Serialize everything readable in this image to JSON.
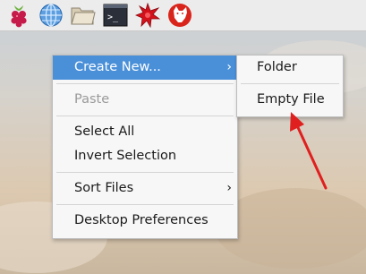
{
  "taskbar": {
    "items": [
      {
        "icon": "raspberry-menu-icon"
      },
      {
        "icon": "web-browser-globe-icon"
      },
      {
        "icon": "file-manager-folder-icon"
      },
      {
        "icon": "terminal-icon",
        "glyph": ">_"
      },
      {
        "icon": "mathematica-star-icon"
      },
      {
        "icon": "wolfram-wolf-icon"
      }
    ]
  },
  "context_menu": {
    "items": [
      {
        "label": "Create New...",
        "state": "highlighted",
        "submenu": "›"
      },
      {
        "label": "Paste",
        "state": "disabled"
      },
      {
        "label": "Select All"
      },
      {
        "label": "Invert Selection"
      },
      {
        "label": "Sort Files",
        "submenu": "›"
      },
      {
        "label": "Desktop Preferences"
      }
    ]
  },
  "submenu": {
    "items": [
      {
        "label": "Folder"
      },
      {
        "label": "Empty File"
      }
    ]
  },
  "colors": {
    "highlight": "#4a90d9",
    "annotation_arrow": "#e01f1f"
  }
}
